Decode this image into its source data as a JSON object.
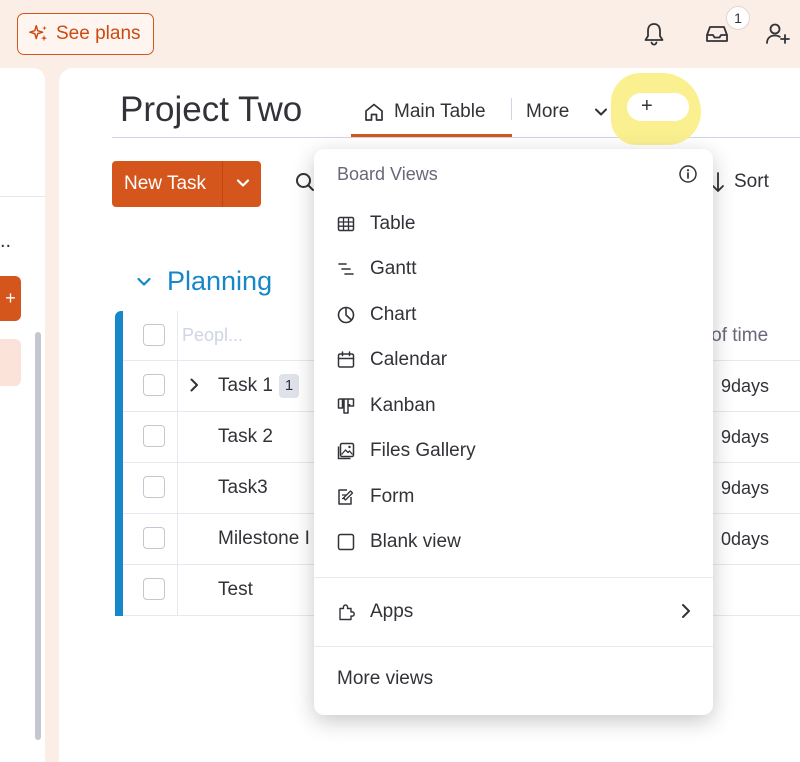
{
  "topbar": {
    "see_plans": "See plans",
    "inbox_count": "1"
  },
  "board": {
    "title": "Project Two",
    "tabs": {
      "main": "Main Table",
      "more": "More",
      "add": "+"
    },
    "new_task": "New Task",
    "sort": "Sort"
  },
  "group": {
    "title": "Planning",
    "column_placeholder": "Peopl...",
    "length_column": "th of time",
    "rows": [
      {
        "name": "Task 1",
        "subitems": "1",
        "days": "9days"
      },
      {
        "name": "Task 2",
        "days": "9days"
      },
      {
        "name": "Task3",
        "days": "9days"
      },
      {
        "name": "Milestone I",
        "days": "0days"
      },
      {
        "name": "Test",
        "days": ""
      }
    ]
  },
  "left_panel": {
    "ellipsis": "..",
    "button": "+"
  },
  "dropdown": {
    "title": "Board Views",
    "items": [
      {
        "label": "Table",
        "icon": "table-icon"
      },
      {
        "label": "Gantt",
        "icon": "gantt-icon"
      },
      {
        "label": "Chart",
        "icon": "chart-icon"
      },
      {
        "label": "Calendar",
        "icon": "calendar-icon"
      },
      {
        "label": "Kanban",
        "icon": "kanban-icon"
      },
      {
        "label": "Files Gallery",
        "icon": "gallery-icon"
      },
      {
        "label": "Form",
        "icon": "form-icon"
      },
      {
        "label": "Blank view",
        "icon": "blank-view-icon"
      }
    ],
    "apps": "Apps",
    "more_views": "More views"
  },
  "colors": {
    "accent": "#d4561c",
    "group": "#1687c9",
    "highlight": "#fbef8a",
    "background": "#fbeee6"
  }
}
